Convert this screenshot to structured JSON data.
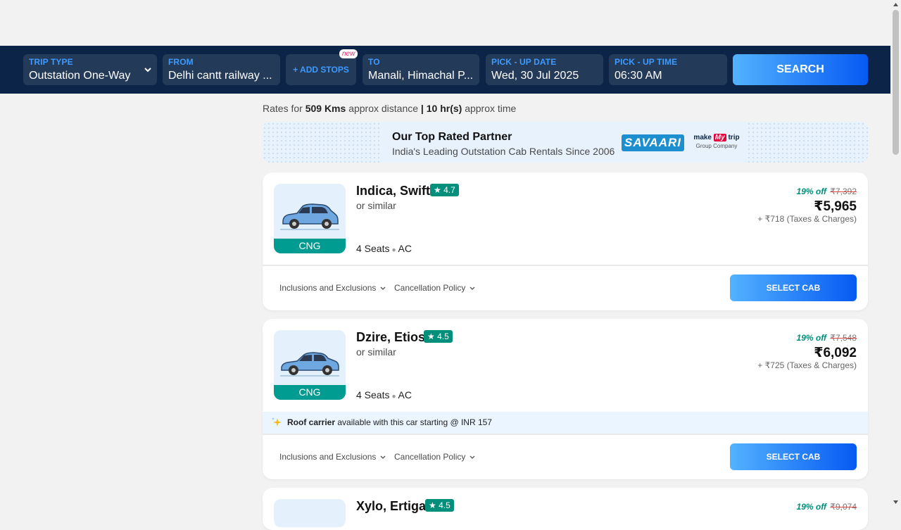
{
  "search": {
    "trip_type": {
      "label": "TRIP TYPE",
      "value": "Outstation One-Way"
    },
    "from": {
      "label": "FROM",
      "value": "Delhi cantt railway ..."
    },
    "add_stops": {
      "label": "+ ADD STOPS",
      "badge": "new"
    },
    "to": {
      "label": "TO",
      "value": "Manali, Himachal P..."
    },
    "pickup_date": {
      "label": "PICK - UP DATE",
      "value": "Wed, 30 Jul 2025"
    },
    "pickup_time": {
      "label": "PICK - UP TIME",
      "value": "06:30 AM"
    },
    "search_button": "SEARCH"
  },
  "rates": {
    "prefix": "Rates for",
    "distance": "509 Kms",
    "distance_suffix": "approx distance",
    "separator": "|",
    "time": "10 hr(s)",
    "time_suffix": "approx time"
  },
  "partner": {
    "title": "Our Top Rated Partner",
    "subtitle": "India's Leading Outstation Cab Rentals Since 2006",
    "savaari_logo": "SAVAARI",
    "mmt_make": "make",
    "mmt_my": "My",
    "mmt_trip": "trip",
    "mmt_group": "Group Company"
  },
  "cabs": [
    {
      "name": "Indica, Swift",
      "rating": "★ 4.7",
      "or_similar": "or similar",
      "fuel": "CNG",
      "seats": "4 Seats",
      "ac": "AC",
      "discount": "19% off",
      "original_price": "₹7,392",
      "price": "₹5,965",
      "taxes": "+ ₹718 (Taxes & Charges)",
      "inclusions": "Inclusions and Exclusions",
      "cancellation": "Cancellation Policy",
      "select": "SELECT CAB"
    },
    {
      "name": "Dzire, Etios",
      "rating": "★ 4.5",
      "or_similar": "or similar",
      "fuel": "CNG",
      "seats": "4 Seats",
      "ac": "AC",
      "discount": "19% off",
      "original_price": "₹7,548",
      "price": "₹6,092",
      "taxes": "+ ₹725 (Taxes & Charges)",
      "addon_bold": "Roof carrier",
      "addon_text": "available with this car starting @ INR 157",
      "inclusions": "Inclusions and Exclusions",
      "cancellation": "Cancellation Policy",
      "select": "SELECT CAB"
    },
    {
      "name": "Xylo, Ertiga",
      "rating": "★ 4.5",
      "discount": "19% off",
      "original_price": "₹9,074"
    }
  ],
  "colors": {
    "header_bg": "#0b2447",
    "label_blue": "#3d9bff",
    "button_gradient_start": "#53b2fe",
    "button_gradient_end": "#065af3",
    "rating_green": "#008f7a",
    "fuel_teal": "#009b91"
  }
}
